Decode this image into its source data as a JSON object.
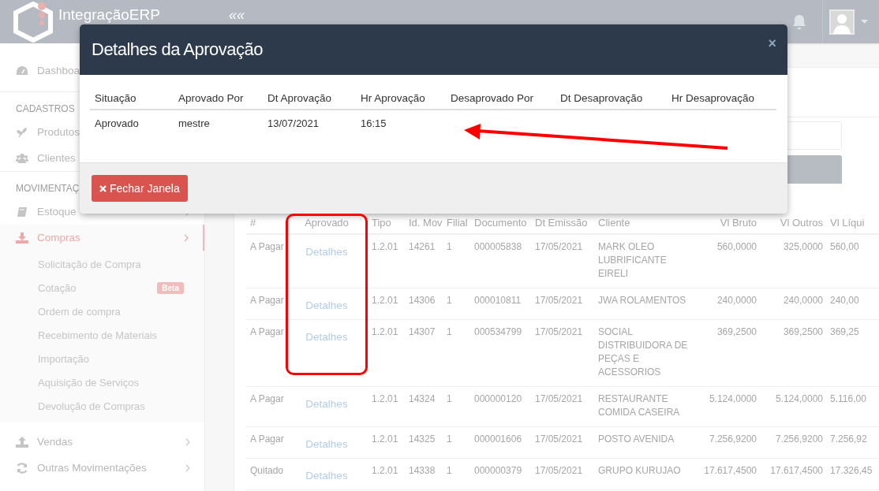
{
  "topbar": {
    "logo_text": "IntegraçãoERP",
    "toggle": "««"
  },
  "sidebar": {
    "items": [
      {
        "kind": "item",
        "label": "Dashboa",
        "selected": false
      },
      {
        "kind": "heading",
        "label": "CADASTROS"
      },
      {
        "kind": "item",
        "label": "Produtos",
        "selected": false
      },
      {
        "kind": "item",
        "label": "Clientes",
        "selected": false
      },
      {
        "kind": "heading",
        "label": "MOVIMENTAÇ"
      },
      {
        "kind": "menu",
        "label": "Estoque",
        "selected": false
      },
      {
        "kind": "menu",
        "label": "Compras",
        "selected": true,
        "expanded": true,
        "children": [
          {
            "label": "Solicitação de Compra"
          },
          {
            "label": "Cotação",
            "badge": "Beta"
          },
          {
            "label": "Ordem de compra"
          },
          {
            "label": "Recebimento de Materiais"
          },
          {
            "label": "Importação"
          },
          {
            "label": "Aquisição de Serviços"
          },
          {
            "label": "Devolução de Compras"
          }
        ]
      },
      {
        "kind": "menu",
        "label": "Vendas",
        "selected": false
      },
      {
        "kind": "menu",
        "label": "Outras Movimentações",
        "selected": false
      }
    ]
  },
  "table": {
    "columns": [
      "#",
      "Aprovado",
      "Tipo",
      "Id. Mov",
      "Filial",
      "Documento",
      "Dt Emissão",
      "Cliente",
      "Vl Bruto",
      "Vl Outros",
      "Vl Líqui"
    ],
    "rows": [
      [
        "A Pagar",
        "Detalhes",
        "1.2.01",
        "14261",
        "1",
        "000005838",
        "17/05/2021",
        "MARK OLEO LUBRIFICANTE EIRELI",
        "560,0000",
        "325,0000",
        "560,00"
      ],
      [
        "A Pagar",
        "Detalhes",
        "1.2.01",
        "14306",
        "1",
        "000010811",
        "17/05/2021",
        "JWA ROLAMENTOS",
        "240,0000",
        "240,0000",
        "240,00"
      ],
      [
        "A Pagar",
        "Detalhes",
        "1.2.01",
        "14307",
        "1",
        "000534799",
        "17/05/2021",
        "SOCIAL DISTRIBUIDORA DE PEÇAS E ACESSORIOS",
        "369,2500",
        "369,2500",
        "369,25"
      ],
      [
        "A Pagar",
        "Detalhes",
        "1.2.01",
        "14324",
        "1",
        "000000120",
        "17/05/2021",
        "RESTAURANTE COMIDA CASEIRA",
        "5.124,0000",
        "5.124,0000",
        "5.116,00"
      ],
      [
        "A Pagar",
        "Detalhes",
        "1.2.01",
        "14325",
        "1",
        "000001606",
        "17/05/2021",
        "POSTO AVENIDA",
        "7.256,9200",
        "7.256,9200",
        "7.256,92"
      ],
      [
        "Quitado",
        "Detalhes",
        "1.2.01",
        "14338",
        "1",
        "000000379",
        "17/05/2021",
        "GRUPO KURUJAO",
        "17.617,4500",
        "17.617,4500",
        "17.326,45"
      ]
    ]
  },
  "modal": {
    "title": "Detalhes da Aprovação",
    "close": "×",
    "columns": [
      "Situação",
      "Aprovado Por",
      "Dt Aprovação",
      "Hr Aprovação",
      "Desaprovado Por",
      "Dt Desaprovação",
      "Hr Desaprovação"
    ],
    "rows": [
      [
        "Aprovado",
        "mestre",
        "13/07/2021",
        "16:15",
        "",
        "",
        ""
      ]
    ],
    "button": "Fechar Janela"
  }
}
